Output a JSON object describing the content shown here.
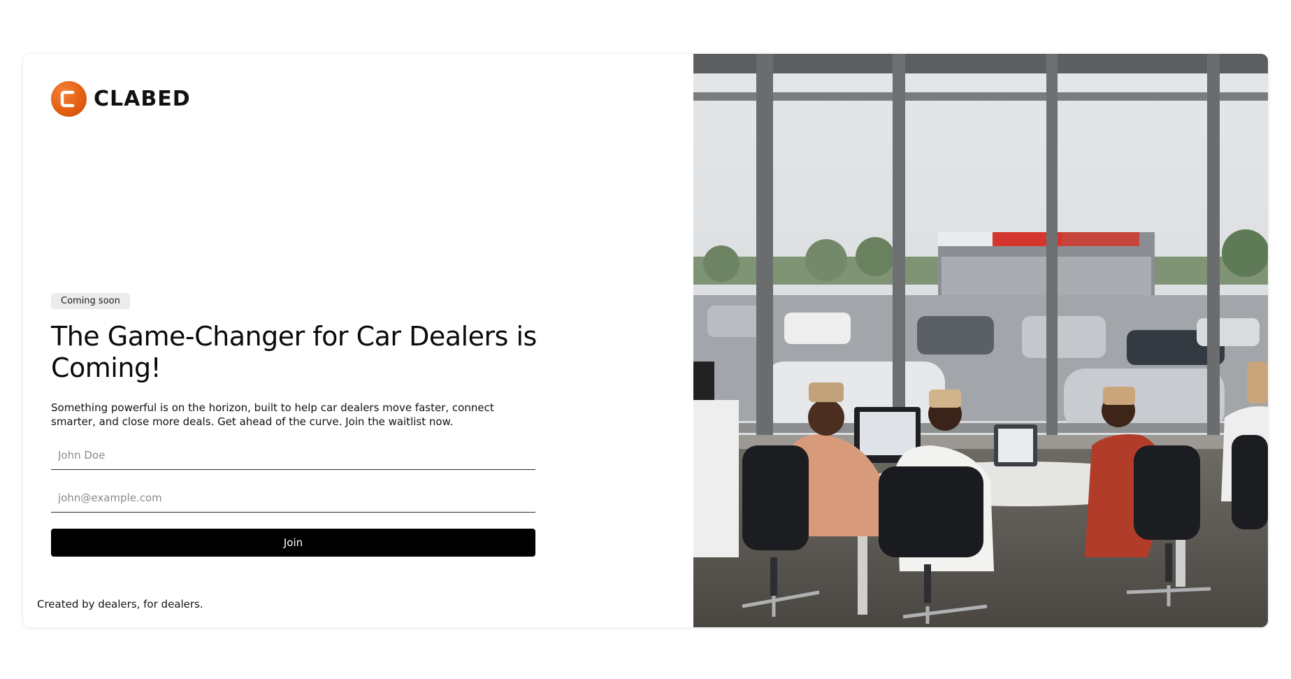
{
  "brand": {
    "name": "CLABED",
    "logo_color": "#e45f12"
  },
  "badge": "Coming soon",
  "headline": "The Game-Changer for Car Dealers is Coming!",
  "description": "Something powerful is on the horizon, built to help car dealers move faster, connect smarter, and close more deals. Get ahead of the curve. Join the waitlist now.",
  "form": {
    "name_placeholder": "John Doe",
    "email_placeholder": "john@example.com",
    "submit_label": "Join"
  },
  "footer": "Created by dealers, for dealers.",
  "hero_image": {
    "icon": "office-photo"
  }
}
